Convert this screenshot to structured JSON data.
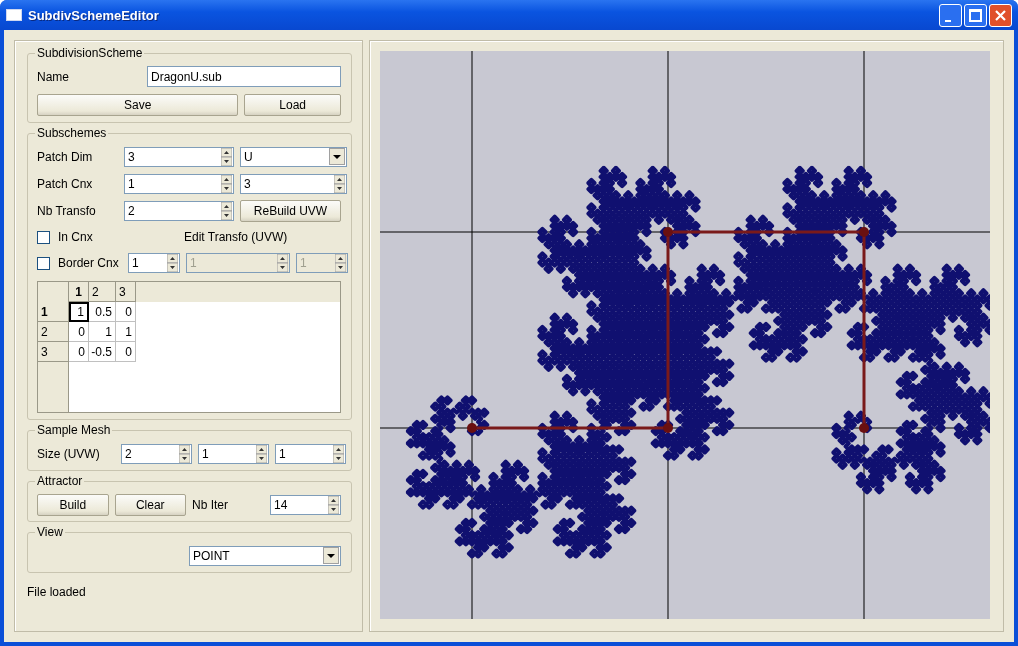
{
  "window": {
    "title": "SubdivSchemeEditor"
  },
  "subdivision_scheme": {
    "title": "SubdivisionScheme",
    "name_label": "Name",
    "name_value": "DragonU.sub",
    "buttons": [
      "Save",
      "Load"
    ]
  },
  "subschemes": {
    "title": "Subschemes",
    "patch_dim": {
      "label": "Patch Dim",
      "value": "3",
      "choice": "U"
    },
    "patch_cnx": {
      "label": "Patch Cnx",
      "value": "1",
      "value_2": "3"
    },
    "nb_transfo": {
      "label": "Nb Transfo",
      "value": "2",
      "button": "ReBuild UVW"
    },
    "in_cnx": {
      "label": "In Cnx",
      "checked": false
    },
    "edit_transfo_label": "Edit Transfo (UVW)",
    "border_cnx": {
      "label": "Border Cnx",
      "checked": false,
      "value": "1"
    },
    "edit_transfo_fields": [
      {
        "value": "1",
        "disabled": true
      },
      {
        "value": "1",
        "disabled": true
      }
    ],
    "grid": {
      "columns": [
        {
          "label": "1",
          "selected": true
        },
        {
          "label": "2",
          "selected": false
        },
        {
          "label": "3",
          "selected": false
        }
      ],
      "rows": [
        {
          "header": "1",
          "selected": true,
          "cells": [
            {
              "value": "1",
              "selected": true
            },
            {
              "value": "0.5",
              "selected": false
            },
            {
              "value": "0",
              "selected": false
            }
          ]
        },
        {
          "header": "2",
          "selected": false,
          "cells": [
            {
              "value": "0",
              "selected": false
            },
            {
              "value": "1",
              "selected": false
            },
            {
              "value": "1",
              "selected": false
            }
          ]
        },
        {
          "header": "3",
          "selected": false,
          "cells": [
            {
              "value": "0",
              "selected": false
            },
            {
              "value": "-0.5",
              "selected": false
            },
            {
              "value": "0",
              "selected": false
            }
          ]
        }
      ]
    }
  },
  "sample_mesh": {
    "title": "Sample Mesh",
    "label": "Size (UVW)",
    "values": [
      "2",
      "1",
      "1"
    ]
  },
  "attractor": {
    "title": "Attractor",
    "buttons": [
      "Build",
      "Clear"
    ],
    "iter_label": "Nb Iter",
    "iter_value": "14"
  },
  "view": {
    "title": "View",
    "mode": "POINT"
  },
  "status_bar": "File loaded"
}
